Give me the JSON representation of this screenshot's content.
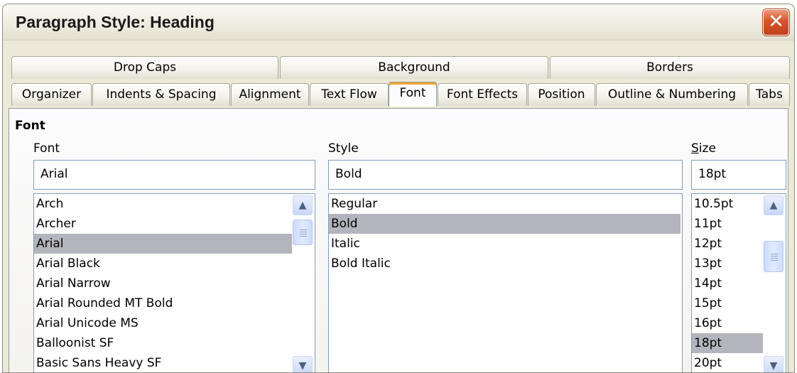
{
  "window": {
    "title": "Paragraph Style: Heading",
    "close_glyph": "✕"
  },
  "tabs_top": [
    "Drop Caps",
    "Background",
    "Borders"
  ],
  "tabs_bottom": [
    "Organizer",
    "Indents & Spacing",
    "Alignment",
    "Text Flow",
    "Font",
    "Font Effects",
    "Position",
    "Outline & Numbering",
    "Tabs"
  ],
  "active_tab": "Font",
  "section_title": "Font",
  "font": {
    "label": "Font",
    "value": "Arial",
    "items": [
      "Arch",
      "Archer",
      "Arial",
      "Arial Black",
      "Arial Narrow",
      "Arial Rounded MT Bold",
      "Arial Unicode MS",
      "Balloonist SF",
      "Basic Sans Heavy SF"
    ],
    "selected": "Arial"
  },
  "style": {
    "label": "Style",
    "value": "Bold",
    "items": [
      "Regular",
      "Bold",
      "Italic",
      "Bold Italic"
    ],
    "selected": "Bold"
  },
  "size": {
    "label": "Size",
    "label_accel_char": "S",
    "label_rest": "ize",
    "value": "18pt",
    "items": [
      "10.5pt",
      "11pt",
      "12pt",
      "13pt",
      "14pt",
      "15pt",
      "16pt",
      "18pt",
      "20pt"
    ],
    "selected": "18pt"
  },
  "icons": {
    "scroll_up": "▲",
    "scroll_down": "▼",
    "thumb": "grip-icon",
    "close": "close-icon"
  },
  "colors": {
    "selection": "#b4b4bc",
    "active_tab_accent": "#f5a534",
    "close_button": "#d8552b"
  }
}
